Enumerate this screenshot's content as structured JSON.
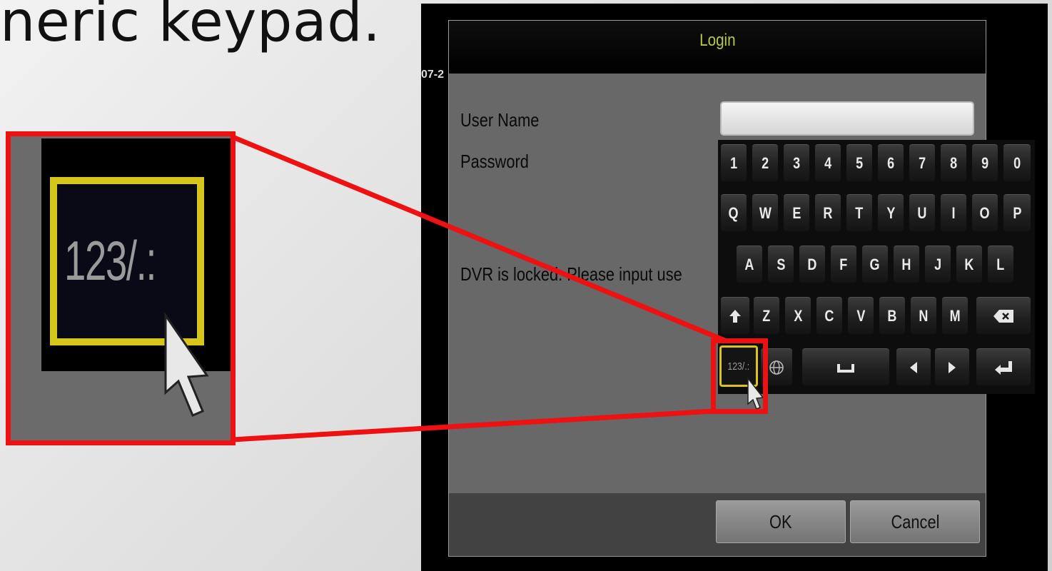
{
  "slide": {
    "heading_fragment": "neric keypad."
  },
  "dvr": {
    "date_fragment": "07-2"
  },
  "dialog": {
    "title": "Login",
    "username_label": "User Name",
    "password_label": "Password",
    "username_value": "",
    "lock_message": "DVR is locked. Please input use",
    "ok_label": "OK",
    "cancel_label": "Cancel"
  },
  "keyboard": {
    "row1": [
      "1",
      "2",
      "3",
      "4",
      "5",
      "6",
      "7",
      "8",
      "9",
      "0"
    ],
    "row2": [
      "Q",
      "W",
      "E",
      "R",
      "T",
      "Y",
      "U",
      "I",
      "O",
      "P"
    ],
    "row3": [
      "A",
      "S",
      "D",
      "F",
      "G",
      "H",
      "J",
      "K",
      "L"
    ],
    "row4": [
      "Z",
      "X",
      "C",
      "V",
      "B",
      "N",
      "M"
    ],
    "symbols_key": "123/.:",
    "icons": {
      "shift": "shift-arrow-icon",
      "backspace": "backspace-icon",
      "language": "globe-icon",
      "space": "space-bar-icon",
      "left": "arrow-left-icon",
      "right": "arrow-right-icon",
      "enter": "enter-icon"
    }
  },
  "callout": {
    "zoom_key_label": "123/.:",
    "color": "#ee1111",
    "highlight_color": "#d8c41a"
  }
}
